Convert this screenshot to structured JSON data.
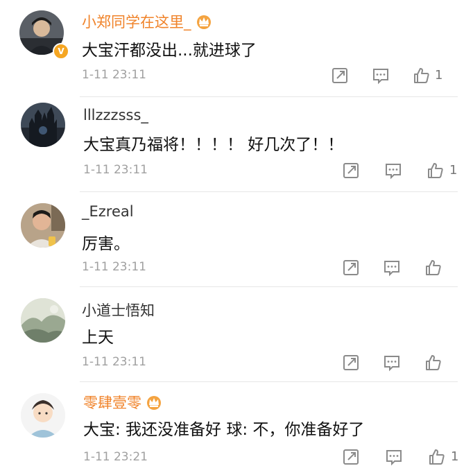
{
  "comments": [
    {
      "username": "小郑同学在这里_",
      "username_color": "#f0832a",
      "verified": true,
      "crown": true,
      "text": "大宝汗都没出...就进球了",
      "time": "1-11 23:11",
      "likes": "1",
      "avatar_icon": "dark-portrait-avatar"
    },
    {
      "username": "lllzzzsss_",
      "username_color": "#333333",
      "verified": false,
      "crown": false,
      "text": "大宝真乃福将！！！！ 好几次了！！",
      "time": "1-11 23:11",
      "likes": "1",
      "avatar_icon": "dark-castle-avatar"
    },
    {
      "username": "_Ezreal",
      "username_color": "#333333",
      "verified": false,
      "crown": false,
      "text": "厉害。",
      "time": "1-11 23:11",
      "likes": "",
      "avatar_icon": "man-photo-avatar"
    },
    {
      "username": "小道士悟知",
      "username_color": "#333333",
      "verified": false,
      "crown": false,
      "text": "上天",
      "time": "1-11 23:11",
      "likes": "",
      "avatar_icon": "landscape-painting-avatar"
    },
    {
      "username": "零肆壹零",
      "username_color": "#f0832a",
      "verified": false,
      "crown": true,
      "text": "大宝: 我还没准备好 球: 不，你准备好了",
      "time": "1-11 23:21",
      "likes": "1",
      "avatar_icon": "cartoon-boy-avatar"
    }
  ],
  "icons": {
    "share": "share-icon",
    "comment": "comment-icon",
    "like": "thumbs-up-icon",
    "crown": "crown-badge-icon",
    "verified": "verified-badge-icon"
  }
}
